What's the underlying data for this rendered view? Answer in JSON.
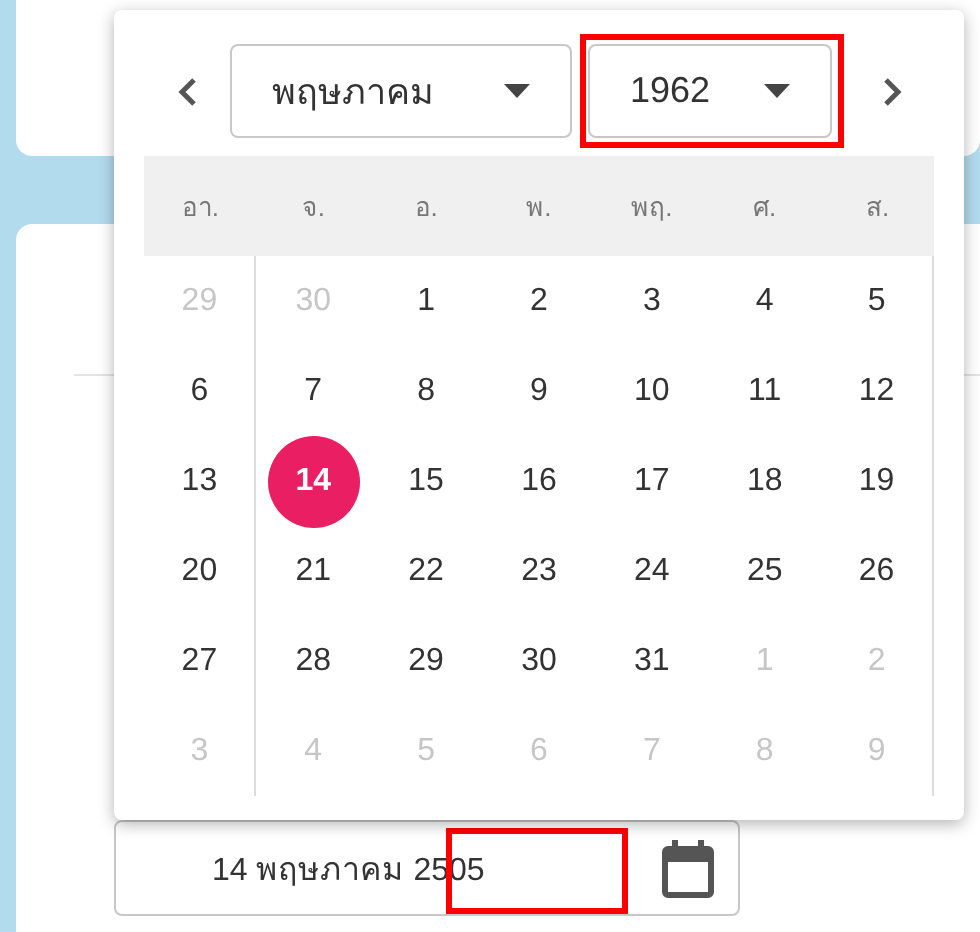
{
  "calendar": {
    "month_select": {
      "value": "พฤษภาคม"
    },
    "year_select": {
      "value": "1962",
      "highlighted": true
    },
    "weekdays": [
      "อา.",
      "จ.",
      "อ.",
      "พ.",
      "พฤ.",
      "ศ.",
      "ส."
    ],
    "weeks": [
      [
        {
          "label": "29",
          "muted": true,
          "selected": false
        },
        {
          "label": "30",
          "muted": true,
          "selected": false
        },
        {
          "label": "1",
          "muted": false,
          "selected": false
        },
        {
          "label": "2",
          "muted": false,
          "selected": false
        },
        {
          "label": "3",
          "muted": false,
          "selected": false
        },
        {
          "label": "4",
          "muted": false,
          "selected": false
        },
        {
          "label": "5",
          "muted": false,
          "selected": false
        }
      ],
      [
        {
          "label": "6",
          "muted": false,
          "selected": false
        },
        {
          "label": "7",
          "muted": false,
          "selected": false
        },
        {
          "label": "8",
          "muted": false,
          "selected": false
        },
        {
          "label": "9",
          "muted": false,
          "selected": false
        },
        {
          "label": "10",
          "muted": false,
          "selected": false
        },
        {
          "label": "11",
          "muted": false,
          "selected": false
        },
        {
          "label": "12",
          "muted": false,
          "selected": false
        }
      ],
      [
        {
          "label": "13",
          "muted": false,
          "selected": false
        },
        {
          "label": "14",
          "muted": false,
          "selected": true
        },
        {
          "label": "15",
          "muted": false,
          "selected": false
        },
        {
          "label": "16",
          "muted": false,
          "selected": false
        },
        {
          "label": "17",
          "muted": false,
          "selected": false
        },
        {
          "label": "18",
          "muted": false,
          "selected": false
        },
        {
          "label": "19",
          "muted": false,
          "selected": false
        }
      ],
      [
        {
          "label": "20",
          "muted": false,
          "selected": false
        },
        {
          "label": "21",
          "muted": false,
          "selected": false
        },
        {
          "label": "22",
          "muted": false,
          "selected": false
        },
        {
          "label": "23",
          "muted": false,
          "selected": false
        },
        {
          "label": "24",
          "muted": false,
          "selected": false
        },
        {
          "label": "25",
          "muted": false,
          "selected": false
        },
        {
          "label": "26",
          "muted": false,
          "selected": false
        }
      ],
      [
        {
          "label": "27",
          "muted": false,
          "selected": false
        },
        {
          "label": "28",
          "muted": false,
          "selected": false
        },
        {
          "label": "29",
          "muted": false,
          "selected": false
        },
        {
          "label": "30",
          "muted": false,
          "selected": false
        },
        {
          "label": "31",
          "muted": false,
          "selected": false
        },
        {
          "label": "1",
          "muted": true,
          "selected": false
        },
        {
          "label": "2",
          "muted": true,
          "selected": false
        }
      ],
      [
        {
          "label": "3",
          "muted": true,
          "selected": false
        },
        {
          "label": "4",
          "muted": true,
          "selected": false
        },
        {
          "label": "5",
          "muted": true,
          "selected": false
        },
        {
          "label": "6",
          "muted": true,
          "selected": false
        },
        {
          "label": "7",
          "muted": true,
          "selected": false
        },
        {
          "label": "8",
          "muted": true,
          "selected": false
        },
        {
          "label": "9",
          "muted": true,
          "selected": false
        }
      ]
    ]
  },
  "date_input": {
    "value": "14 พฤษภาคม 2505",
    "highlighted": true
  }
}
